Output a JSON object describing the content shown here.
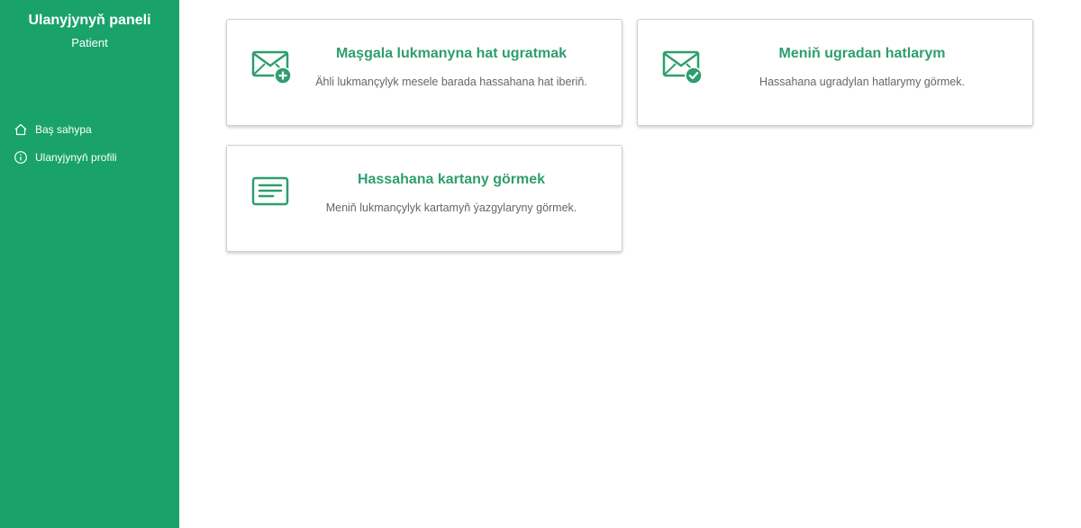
{
  "sidebar": {
    "title": "Ulanyjynyň paneli",
    "subtitle": "Patient",
    "items": [
      {
        "label": "Baş sahypa",
        "icon": "home-icon"
      },
      {
        "label": "Ulanyjynyň profili",
        "icon": "info-icon"
      }
    ]
  },
  "cards": [
    {
      "title": "Maşgala lukmanyna hat ugratmak",
      "description": "Ähli lukmançylyk mesele barada hassahana hat iberiň.",
      "icon": "envelope-plus-icon"
    },
    {
      "title": "Meniň ugradan hatlarym",
      "description": "Hassahana ugradylan hatlarymy görmek.",
      "icon": "envelope-check-icon"
    },
    {
      "title": "Hassahana kartany görmek",
      "description": "Meniň lukmançylyk kartamyň ýazgylaryny görmek.",
      "icon": "document-lines-icon"
    }
  ],
  "colors": {
    "sidebar_bg": "#1aa26b",
    "accent": "#2e9e6e",
    "description_text": "#666666"
  }
}
